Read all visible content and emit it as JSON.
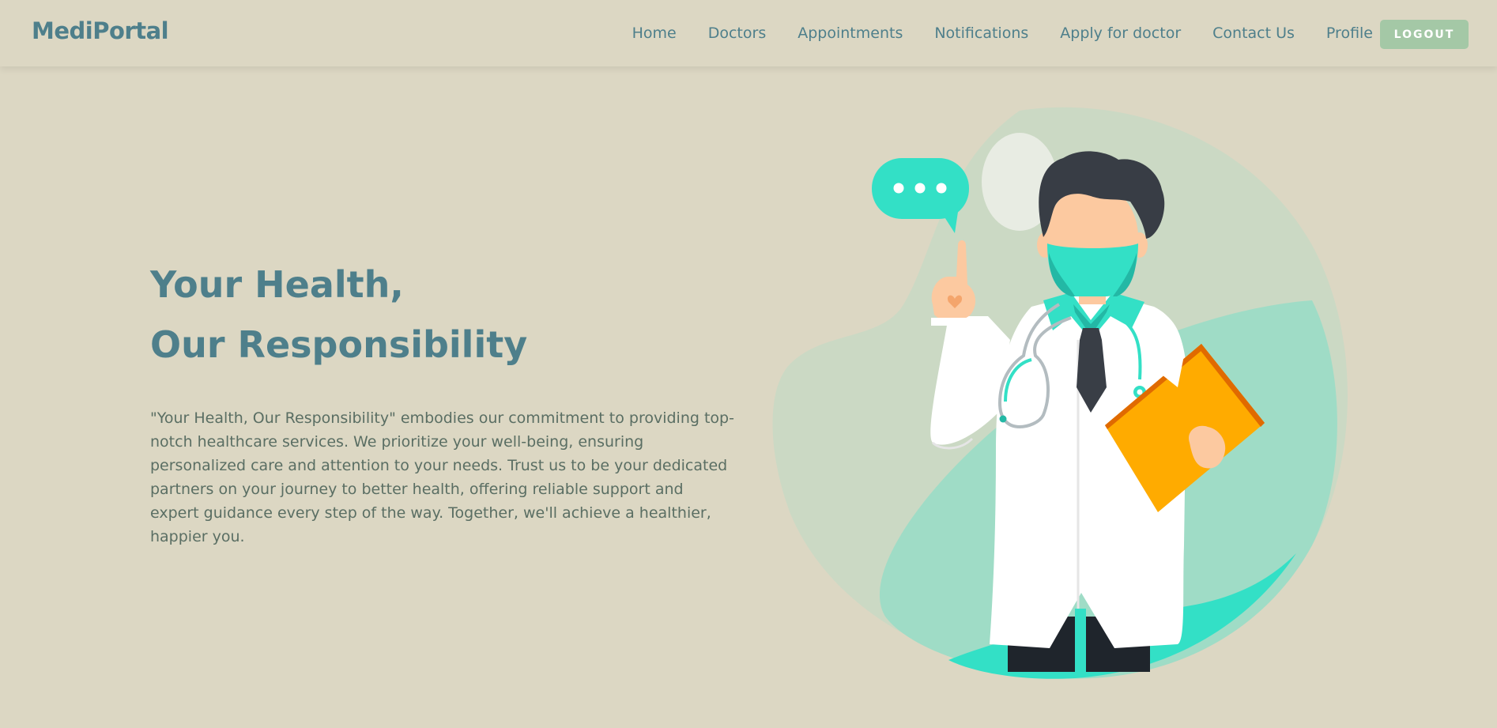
{
  "nav": {
    "brand": "MediPortal",
    "links": [
      "Home",
      "Doctors",
      "Appointments",
      "Notifications",
      "Apply for doctor",
      "Contact Us",
      "Profile"
    ],
    "logout_label": "LOGOUT"
  },
  "hero": {
    "title_line1": "Your Health,",
    "title_line2": "Our Responsibility",
    "description": "\"Your Health, Our Responsibility\" embodies our commitment to providing top-notch healthcare services. We prioritize your well-being, ensuring personalized care and attention to your needs. Trust us to be your dedicated partners on your journey to better health, offering reliable support and expert guidance every step of the way. Together, we'll achieve a healthier, happier you."
  },
  "illustration": {
    "icons": [
      "speech-bubble-icon",
      "doctor-illustration"
    ]
  },
  "colors": {
    "background": "#dcd7c3",
    "primary": "#4e7f8b",
    "logout_button": "#a4c8a6",
    "accent_teal": "#33e0c6",
    "folder": "#ffab00"
  }
}
